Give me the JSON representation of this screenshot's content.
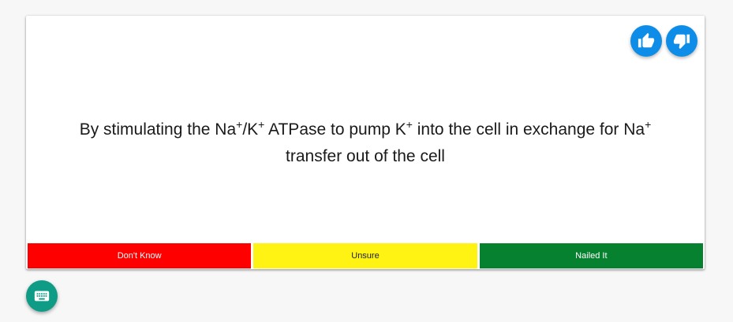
{
  "card": {
    "text_parts": [
      {
        "t": "By stimulating the Na",
        "sup": false
      },
      {
        "t": "+",
        "sup": true
      },
      {
        "t": "/K",
        "sup": false
      },
      {
        "t": "+",
        "sup": true
      },
      {
        "t": " ATPase to pump K",
        "sup": false
      },
      {
        "t": "+",
        "sup": true
      },
      {
        "t": " into the cell in exchange for Na",
        "sup": false
      },
      {
        "t": "+",
        "sup": true
      },
      {
        "t": " transfer out of the cell",
        "sup": false
      }
    ]
  },
  "feedback": {
    "thumbs_up_icon": "thumbs-up-icon",
    "thumbs_down_icon": "thumbs-down-icon",
    "button_color": "#0d8ce8"
  },
  "answers": [
    {
      "label": "Don't Know",
      "bg": "#ff0000",
      "fg": "#ffffff"
    },
    {
      "label": "Unsure",
      "bg": "#fff314",
      "fg": "#222222"
    },
    {
      "label": "Nailed It",
      "bg": "#068130",
      "fg": "#ffffff"
    }
  ],
  "fab": {
    "icon": "keyboard-icon",
    "color": "#0f9c87"
  }
}
